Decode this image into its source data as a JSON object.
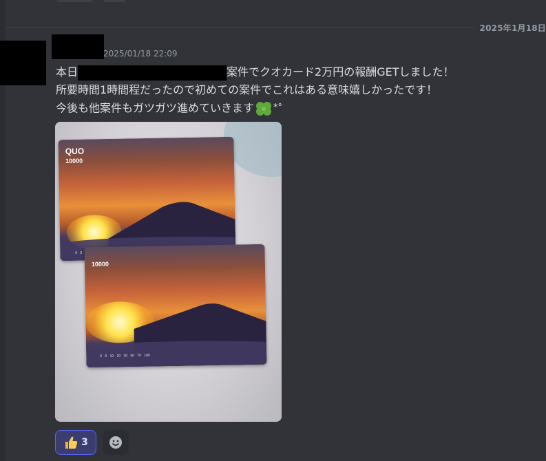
{
  "date_divider": "2025年1月18日",
  "message": {
    "timestamp": "2025/01/18 22:09",
    "line1_prefix": "本日",
    "line1_suffix": "案件でクオカード2万円の報酬GETしました！",
    "line2": "所要時間1時間程だったので初めての案件でこれはある意味嬉しかったです！",
    "line3_text": "今後も他案件もガツガツ進めていきます",
    "line3_emoji": "four-leaf-clover",
    "line3_after": "*°"
  },
  "attachment": {
    "cards": [
      {
        "brand": "QUO",
        "value": "10000",
        "scale": "0 5 10 20 30 50 70 100"
      },
      {
        "value": "10000",
        "scale": "0 5 10 20 30 50 70 100"
      }
    ]
  },
  "reactions": [
    {
      "emoji": "thumbs-up",
      "count": "3",
      "selected": true
    }
  ],
  "colors": {
    "background": "#313338",
    "text": "#dbdee1",
    "muted": "#949ba4",
    "reaction_border": "#5865f2",
    "reaction_bg": "#3b3d70"
  }
}
